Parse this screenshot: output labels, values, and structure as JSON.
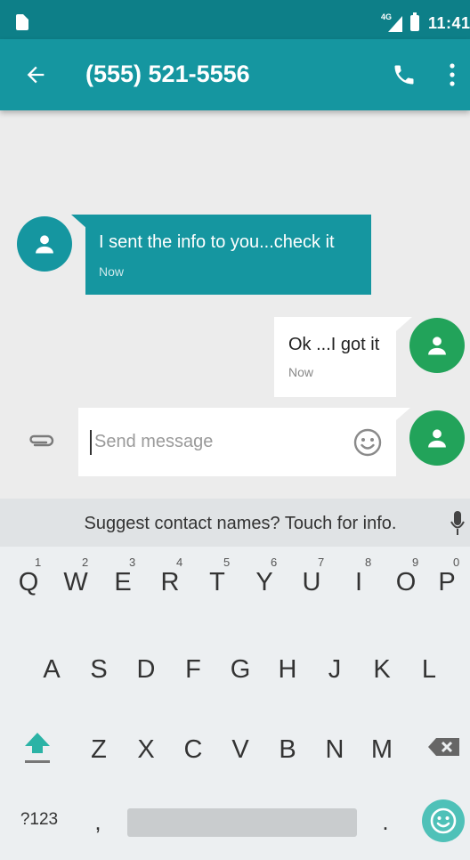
{
  "status_bar": {
    "network": "4G",
    "time": "11:41"
  },
  "app_bar": {
    "title": "(555) 521-5556"
  },
  "messages": [
    {
      "direction": "incoming",
      "text": "I sent the info to you...check it",
      "time": "Now"
    },
    {
      "direction": "outgoing",
      "text": "Ok ...I got it",
      "time": "Now"
    }
  ],
  "compose": {
    "placeholder": "Send message",
    "value": ""
  },
  "keyboard": {
    "suggestion": "Suggest contact names? Touch for info.",
    "row1": [
      {
        "letter": "Q",
        "hint": "1"
      },
      {
        "letter": "W",
        "hint": "2"
      },
      {
        "letter": "E",
        "hint": "3"
      },
      {
        "letter": "R",
        "hint": "4"
      },
      {
        "letter": "T",
        "hint": "5"
      },
      {
        "letter": "Y",
        "hint": "6"
      },
      {
        "letter": "U",
        "hint": "7"
      },
      {
        "letter": "I",
        "hint": "8"
      },
      {
        "letter": "O",
        "hint": "9"
      },
      {
        "letter": "P",
        "hint": "0"
      }
    ],
    "row2": [
      "A",
      "S",
      "D",
      "F",
      "G",
      "H",
      "J",
      "K",
      "L"
    ],
    "row3": [
      "Z",
      "X",
      "C",
      "V",
      "B",
      "N",
      "M"
    ],
    "symbols_label": "?123",
    "comma_label": ",",
    "period_label": "."
  },
  "colors": {
    "teal_dark": "#0d7f88",
    "teal": "#1596a0",
    "green": "#22a35a",
    "emoji_key": "#4fc1b8"
  },
  "icons": [
    "sim-icon",
    "signal-icon",
    "battery-icon",
    "back-arrow-icon",
    "phone-icon",
    "more-vert-icon",
    "person-icon",
    "attach-icon",
    "emoji-icon",
    "mic-icon",
    "shift-icon",
    "backspace-icon",
    "emoji-key-icon"
  ]
}
